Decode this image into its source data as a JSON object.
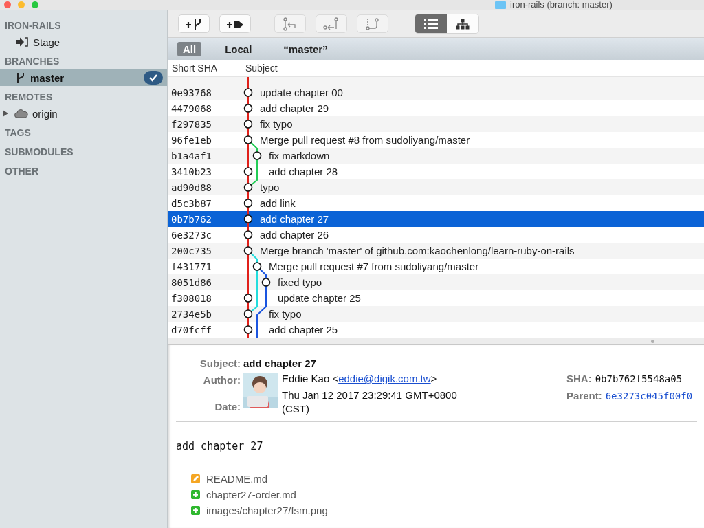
{
  "window": {
    "title": "iron-rails (branch: master)"
  },
  "sidebar": {
    "sections": [
      {
        "title": "IRON-RAILS",
        "items": [
          {
            "label": "Stage",
            "kind": "stage",
            "selected": false,
            "current": false
          }
        ]
      },
      {
        "title": "BRANCHES",
        "items": [
          {
            "label": "master",
            "kind": "branch",
            "selected": true,
            "current": true
          }
        ]
      },
      {
        "title": "REMOTES",
        "items": [
          {
            "label": "origin",
            "kind": "remote",
            "selected": false,
            "current": false,
            "expanded": false
          }
        ]
      },
      {
        "title": "TAGS"
      },
      {
        "title": "SUBMODULES"
      },
      {
        "title": "OTHER"
      }
    ]
  },
  "toolbar": {
    "buttons": [
      {
        "disabled": false
      },
      {
        "disabled": false
      },
      {
        "disabled": true
      },
      {
        "disabled": true
      },
      {
        "disabled": true
      }
    ],
    "view_modes": [
      {
        "selected": true
      },
      {
        "selected": false
      }
    ]
  },
  "filters": [
    {
      "label": "All",
      "selected": true
    },
    {
      "label": "Local",
      "selected": false
    },
    {
      "label": "“master”",
      "selected": false
    }
  ],
  "table": {
    "columns": [
      "Short SHA",
      "Subject"
    ],
    "rows": [
      {
        "sha": "0e93768",
        "subject": "update chapter 00",
        "selected": false
      },
      {
        "sha": "4479068",
        "subject": "add chapter 29",
        "selected": false
      },
      {
        "sha": "f297835",
        "subject": "fix typo",
        "selected": false
      },
      {
        "sha": "96fe1eb",
        "subject": "Merge pull request #8 from sudoliyang/master",
        "selected": false
      },
      {
        "sha": "b1a4af1",
        "subject": "fix markdown",
        "selected": false
      },
      {
        "sha": "3410b23",
        "subject": "add chapter 28",
        "selected": false
      },
      {
        "sha": "ad90d88",
        "subject": "typo",
        "selected": false
      },
      {
        "sha": "d5c3b87",
        "subject": "add link",
        "selected": false
      },
      {
        "sha": "0b7b762",
        "subject": "add chapter 27",
        "selected": true
      },
      {
        "sha": "6e3273c",
        "subject": "add chapter 26",
        "selected": false
      },
      {
        "sha": "200c735",
        "subject": "Merge branch 'master' of github.com:kaochenlong/learn-ruby-on-rails",
        "selected": false
      },
      {
        "sha": "f431771",
        "subject": "Merge pull request #7 from sudoliyang/master",
        "selected": false
      },
      {
        "sha": "8051d86",
        "subject": "fixed typo",
        "selected": false
      },
      {
        "sha": "f308018",
        "subject": "update chapter 25",
        "selected": false
      },
      {
        "sha": "2734e5b",
        "subject": "fix typo",
        "selected": false
      },
      {
        "sha": "d70fcff",
        "subject": "add chapter 25",
        "selected": false
      }
    ]
  },
  "details": {
    "subject_label": "Subject:",
    "subject": "add chapter 27",
    "author_label": "Author:",
    "author_name": "Eddie Kao <",
    "author_email": "eddie@digik.com.tw",
    "author_suffix": ">",
    "date_label": "Date:",
    "date": "Thu Jan 12 2017 23:29:41 GMT+0800 (CST)",
    "sha_label": "SHA:",
    "sha": "0b7b762f5548a05",
    "parent_label": "Parent:",
    "parent": "6e3273c045f00f0",
    "message": "add chapter 27",
    "files": [
      {
        "name": "README.md",
        "kind": "modified"
      },
      {
        "name": "chapter27-order.md",
        "kind": "added"
      },
      {
        "name": "images/chapter27/fsm.png",
        "kind": "added"
      }
    ]
  }
}
